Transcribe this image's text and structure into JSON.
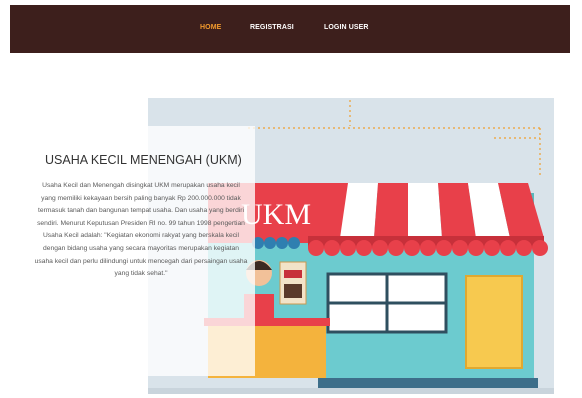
{
  "nav": {
    "items": [
      {
        "label": "HOME",
        "active": true
      },
      {
        "label": "REGISTRASI",
        "active": false
      },
      {
        "label": "LOGIN USER",
        "active": false
      }
    ],
    "background": "#3d1f1c",
    "active_color": "#f39a2d"
  },
  "hero": {
    "sign_text": "UKM",
    "title": "USAHA KECIL MENENGAH (UKM)",
    "description": "Usaha Kecil dan Menengah disingkat UKM merupakan usaha kecil yang memiliki kekayaan bersih paling banyak Rp 200.000.000 tidak termasuk tanah dan bangunan tempat usaha. Dan usaha yang berdiri sendiri. Menurut Keputusan Presiden RI no. 99 tahun 1998 pengertian Usaha Kecil adalah: \"Kegiatan ekonomi rakyat yang berskala kecil dengan bidang usaha yang secara mayoritas merupakan kegiatan usaha kecil dan perlu dilindungi untuk mencegah dari persaingan usaha yang tidak sehat.\""
  }
}
